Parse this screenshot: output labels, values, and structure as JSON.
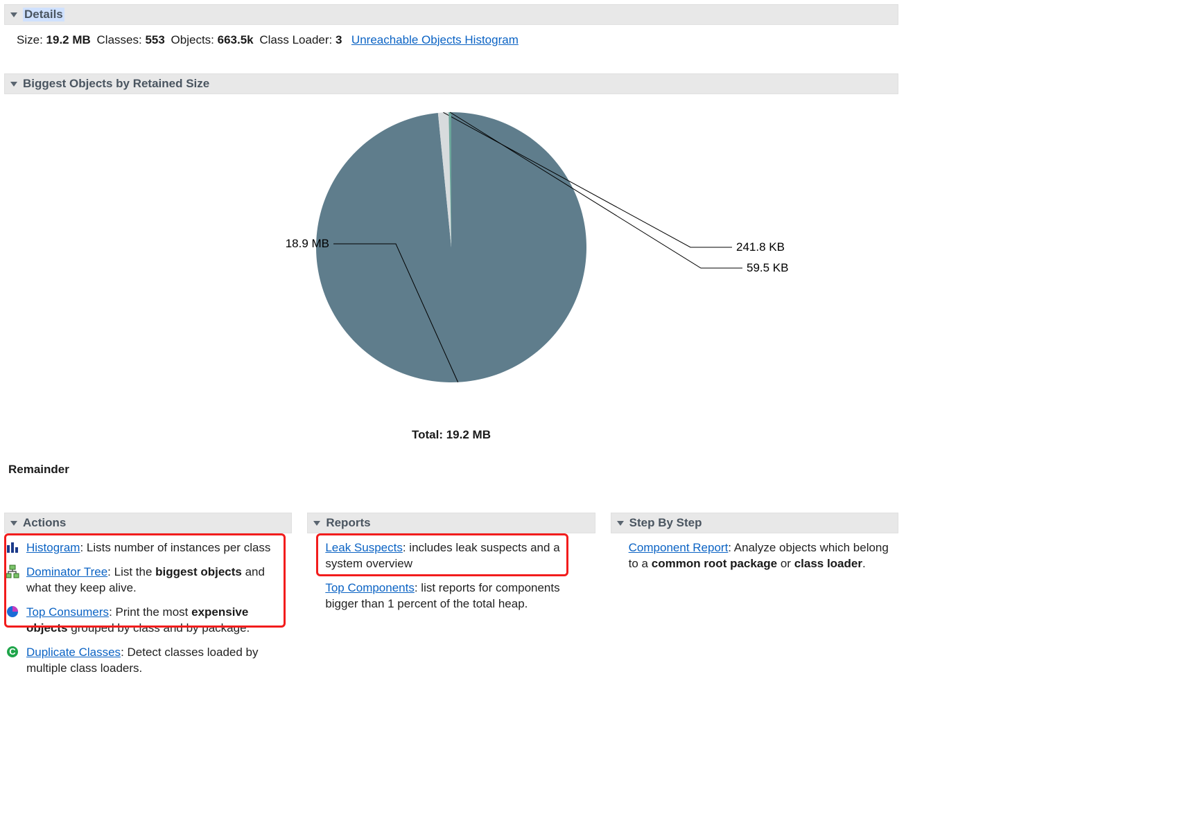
{
  "sections": {
    "details": {
      "title": "Details"
    },
    "biggest": {
      "title": "Biggest Objects by Retained Size"
    },
    "actions": {
      "title": "Actions"
    },
    "reports": {
      "title": "Reports"
    },
    "step": {
      "title": "Step By Step"
    }
  },
  "details": {
    "size_label": "Size:",
    "size_value": "19.2 MB",
    "classes_label": "Classes:",
    "classes_value": "553",
    "objects_label": "Objects:",
    "objects_value": "663.5k",
    "classloader_label": "Class Loader:",
    "classloader_value": "3",
    "unreachable_link": "Unreachable Objects Histogram"
  },
  "chart_data": {
    "type": "pie",
    "title": "Biggest Objects by Retained Size",
    "categories": [
      "18.9 MB",
      "241.8 KB",
      "59.5 KB"
    ],
    "values": [
      19353600,
      247603,
      60928
    ],
    "labels": [
      "18.9 MB",
      "241.8 KB",
      "59.5 KB"
    ],
    "total_label": "Total: 19.2 MB",
    "colors": [
      "#5f7d8c",
      "#d7dbdd",
      "#6aa59a"
    ],
    "remainder_label": "Remainder"
  },
  "actions": [
    {
      "link": "Histogram",
      "desc": ": Lists number of instances per class",
      "icon": "histogram"
    },
    {
      "link": "Dominator Tree",
      "desc_pre": ": List the ",
      "bold": "biggest objects",
      "desc_post": " and what they keep alive.",
      "icon": "tree"
    },
    {
      "link": "Top Consumers",
      "desc_pre": ": Print the most ",
      "bold": "expensive objects",
      "desc_post": " grouped by class and by package.",
      "icon": "globe"
    },
    {
      "link": "Duplicate Classes",
      "desc": ": Detect classes loaded by multiple class loaders.",
      "icon": "duplicate"
    }
  ],
  "reports": [
    {
      "link": "Leak Suspects",
      "desc": ": includes leak suspects and a system overview"
    },
    {
      "link": "Top Components",
      "desc": ": list reports for components bigger than 1 percent of the total heap."
    }
  ],
  "step": [
    {
      "link": "Component Report",
      "desc_pre": ": Analyze objects which belong to a ",
      "bold": "common root package",
      "mid": " or ",
      "bold2": "class loader",
      "desc_post": "."
    }
  ]
}
